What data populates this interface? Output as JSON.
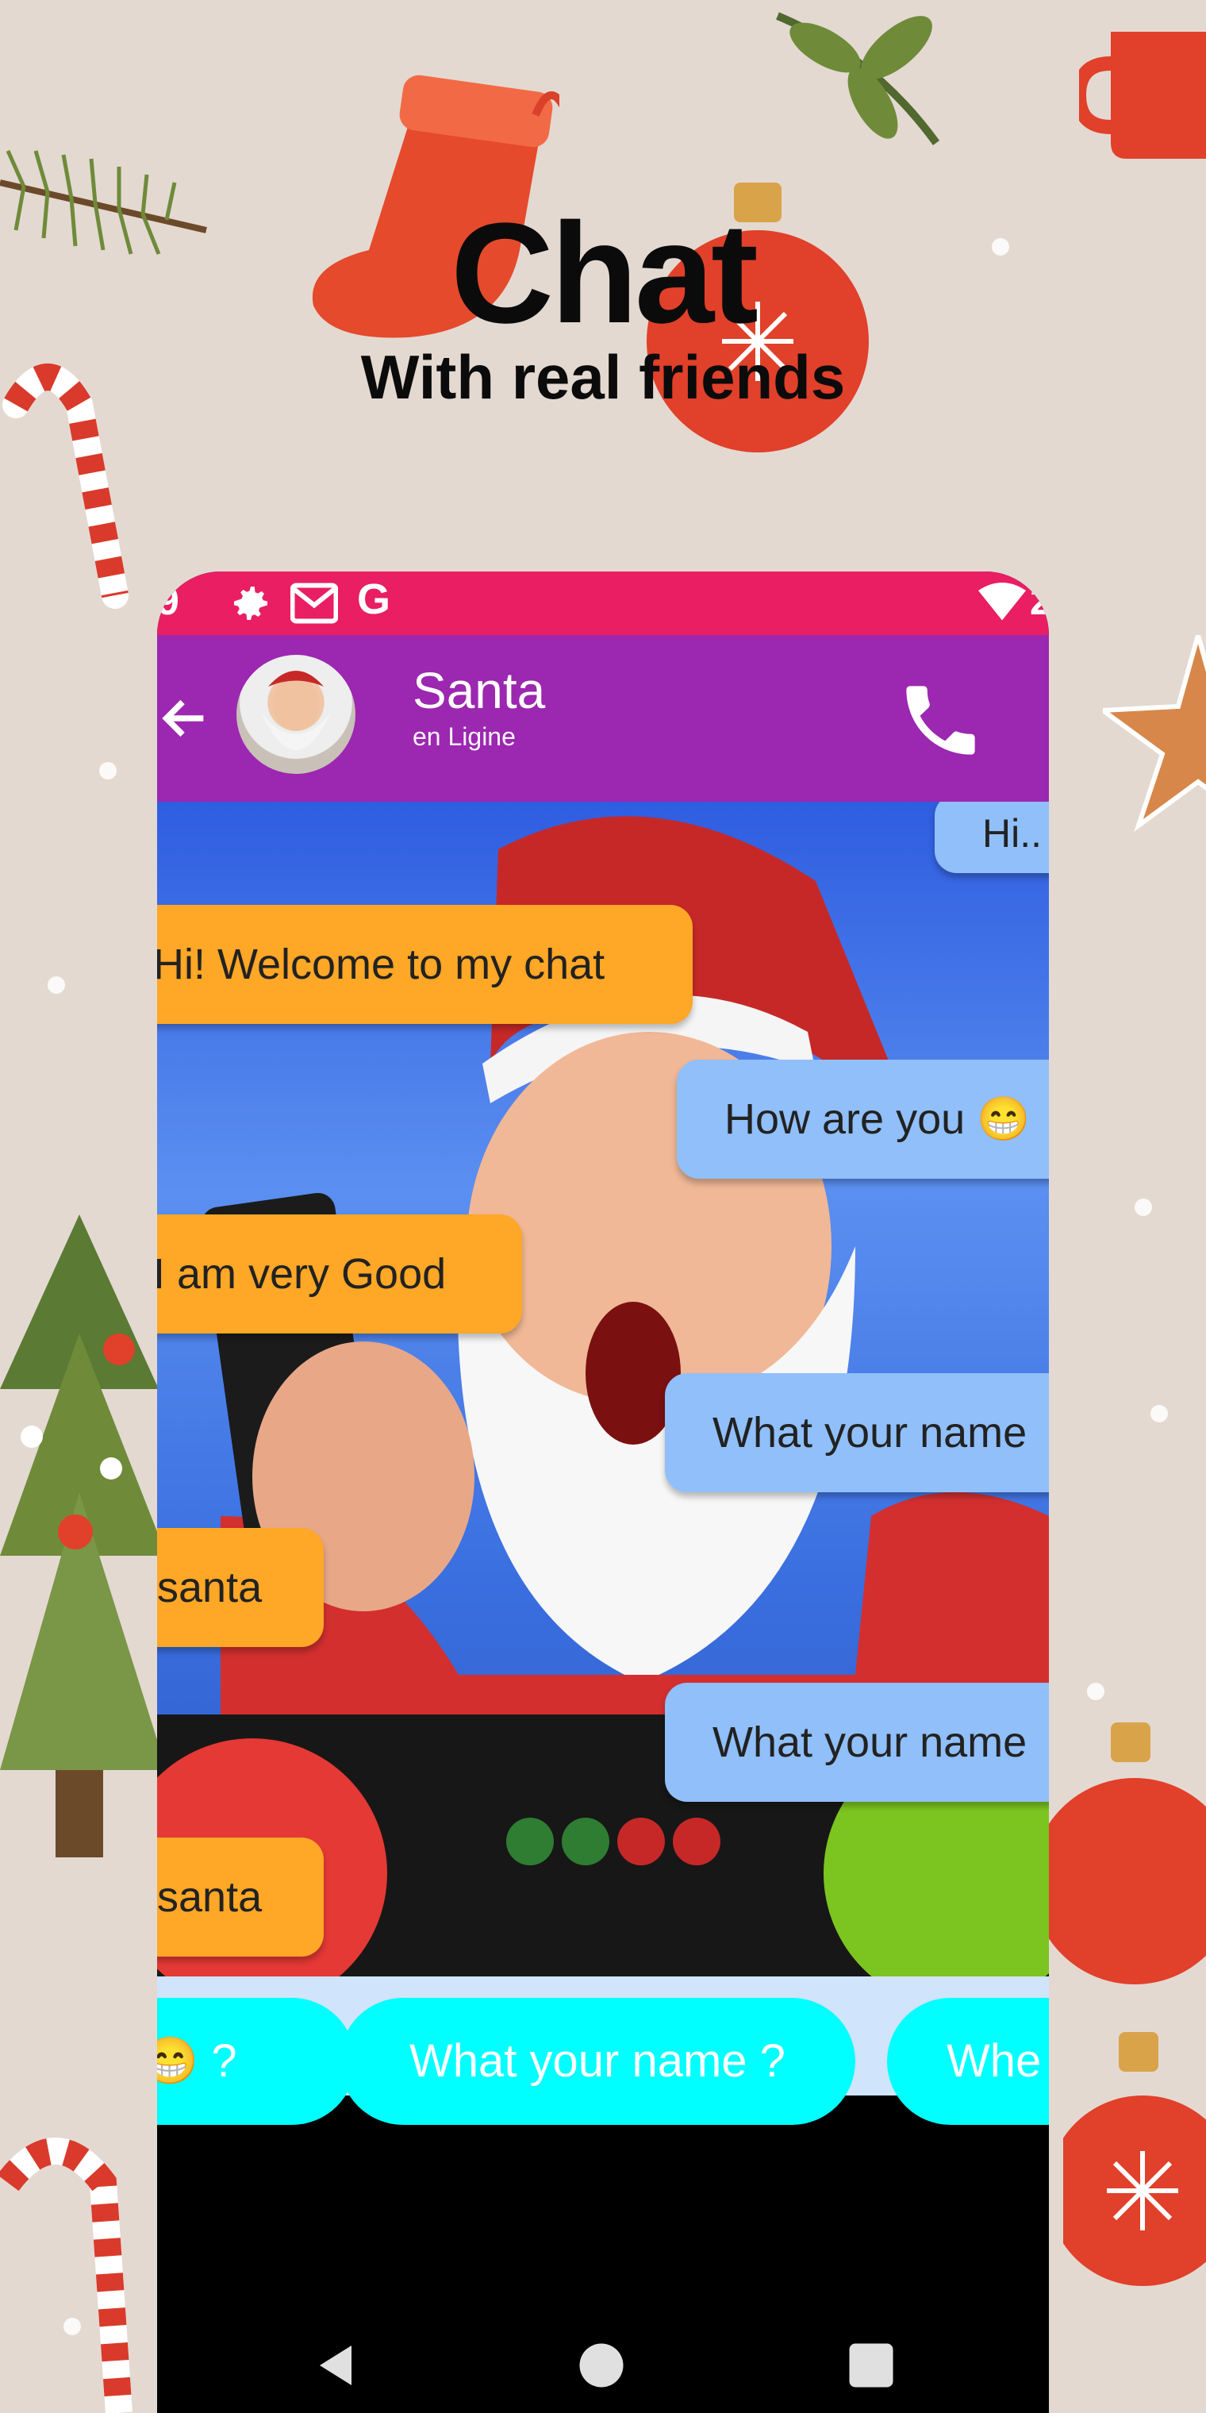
{
  "headline": {
    "title": "Chat",
    "subtitle": "With real friends"
  },
  "statusbar": {
    "time_fragment": "9",
    "right_fragment": "2"
  },
  "contact": {
    "name": "Santa",
    "status": "en Ligine"
  },
  "messages": [
    {
      "from": "sent",
      "text": "Hi.."
    },
    {
      "from": "received",
      "text": "Hi! Welcome to my chat"
    },
    {
      "from": "sent",
      "text": "How are you 😁"
    },
    {
      "from": "received",
      "text": "I am very Good"
    },
    {
      "from": "sent",
      "text": "What your name"
    },
    {
      "from": "received",
      "text": "santa"
    },
    {
      "from": "sent",
      "text": "What your name"
    },
    {
      "from": "received",
      "text": "santa"
    }
  ],
  "quick_replies": [
    "😁 ?",
    "What your name ?",
    "Whe"
  ],
  "colors": {
    "background": "#e3d9d1",
    "status_bar": "#e91e63",
    "app_bar": "#9c27b0",
    "received_bubble": "#ffa726",
    "sent_bubble": "#90bff9",
    "quick_reply": "#00ffff"
  },
  "icons": [
    "back-arrow-icon",
    "phone-call-icon",
    "settings-icon",
    "gmail-icon",
    "google-icon",
    "wifi-icon",
    "nav-back-icon",
    "nav-home-icon",
    "nav-recents-icon"
  ]
}
